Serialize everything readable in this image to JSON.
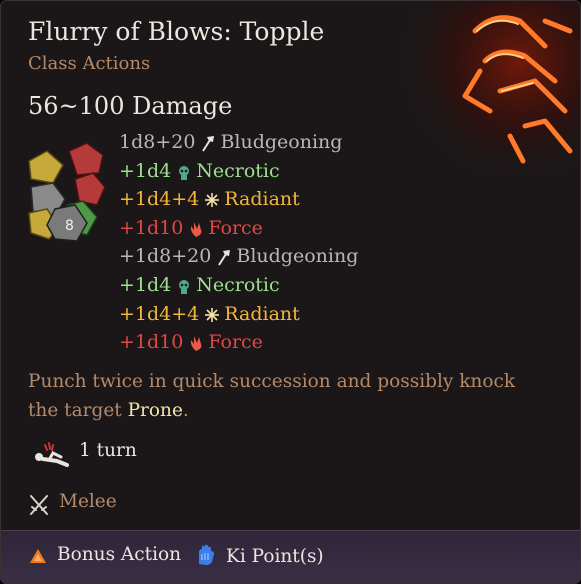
{
  "spell": {
    "title": "Flurry of Blows: Topple",
    "subtitle": "Class Actions",
    "icon": "flurry-of-blows-fist-icon"
  },
  "damage": {
    "total": "56~100 Damage",
    "dice_icon": "dice-cluster-icon",
    "lines": [
      {
        "amount": "1d8+20",
        "type": "Bludgeoning",
        "icon": "bludgeoning-icon",
        "color": "#bcb7b4"
      },
      {
        "amount": "+1d4",
        "type": "Necrotic",
        "icon": "necrotic-icon",
        "color": "#9ce08f"
      },
      {
        "amount": "+1d4+4",
        "type": "Radiant",
        "icon": "radiant-icon",
        "color": "#f2b63a"
      },
      {
        "amount": "+1d10",
        "type": "Force",
        "icon": "force-icon",
        "color": "#e04846"
      },
      {
        "amount": "+1d8+20",
        "type": "Bludgeoning",
        "icon": "bludgeoning-icon",
        "color": "#bcb7b4"
      },
      {
        "amount": "+1d4",
        "type": "Necrotic",
        "icon": "necrotic-icon",
        "color": "#9ce08f"
      },
      {
        "amount": "+1d4+4",
        "type": "Radiant",
        "icon": "radiant-icon",
        "color": "#f2b63a"
      },
      {
        "amount": "+1d10",
        "type": "Force",
        "icon": "force-icon",
        "color": "#e04846"
      }
    ]
  },
  "description": {
    "text": "Punch twice in quick succession and possibly knock the target ",
    "keyword": "Prone",
    "end": "."
  },
  "condition": {
    "icon": "prone-icon",
    "duration": "1 turn"
  },
  "range": {
    "icon": "crossed-swords-icon",
    "label": "Melee"
  },
  "costs": [
    {
      "icon": "bonus-action-icon",
      "label": "Bonus Action",
      "color": "#f07a1e"
    },
    {
      "icon": "ki-point-icon",
      "label": "Ki Point(s)",
      "color": "#3a7ee8"
    }
  ]
}
